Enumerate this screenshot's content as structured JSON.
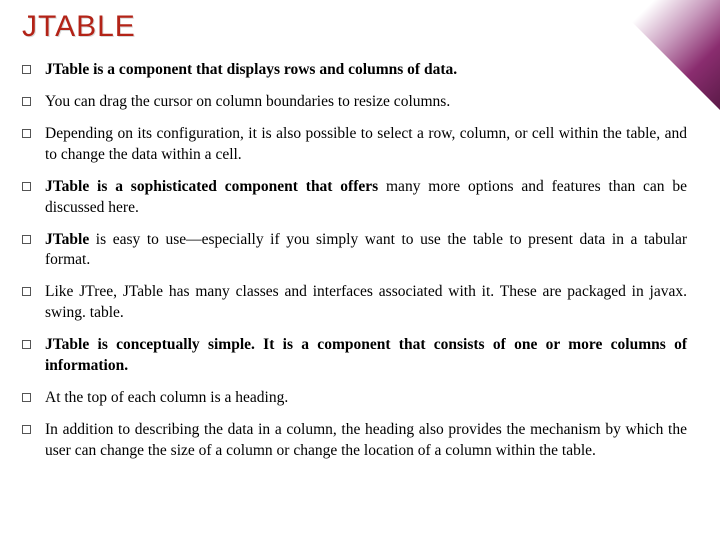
{
  "title": "JTABLE",
  "bullets": [
    {
      "bold": true,
      "lead": "",
      "text": "JTable is a component that displays rows and columns of data."
    },
    {
      "bold": false,
      "lead": "",
      "text": "You can drag the cursor on column boundaries to resize columns."
    },
    {
      "bold": false,
      "lead": "",
      "text": "Depending on its configuration, it is also possible to select a row, column, or cell within the table, and to change the data within a cell."
    },
    {
      "bold": false,
      "lead": "JTable is a sophisticated component that offers",
      "text": " many more options and features than can be discussed here."
    },
    {
      "bold": false,
      "lead": "JTable",
      "text": "  is easy to use—especially if you simply want to use the table to present data in a tabular format."
    },
    {
      "bold": false,
      "lead": "",
      "text": "Like JTree, JTable has many classes and interfaces associated with it. These are packaged in javax. swing. table."
    },
    {
      "bold": true,
      "lead": "",
      "text": "JTable is conceptually simple. It is a component that consists of one or more columns of information."
    },
    {
      "bold": false,
      "lead": "",
      "text": "At the top of each column is a heading."
    },
    {
      "bold": false,
      "lead": "",
      "text": "In addition to describing the data in a column, the heading also provides the mechanism by which the user can change the size of a column or change the location of a column within the table."
    }
  ]
}
